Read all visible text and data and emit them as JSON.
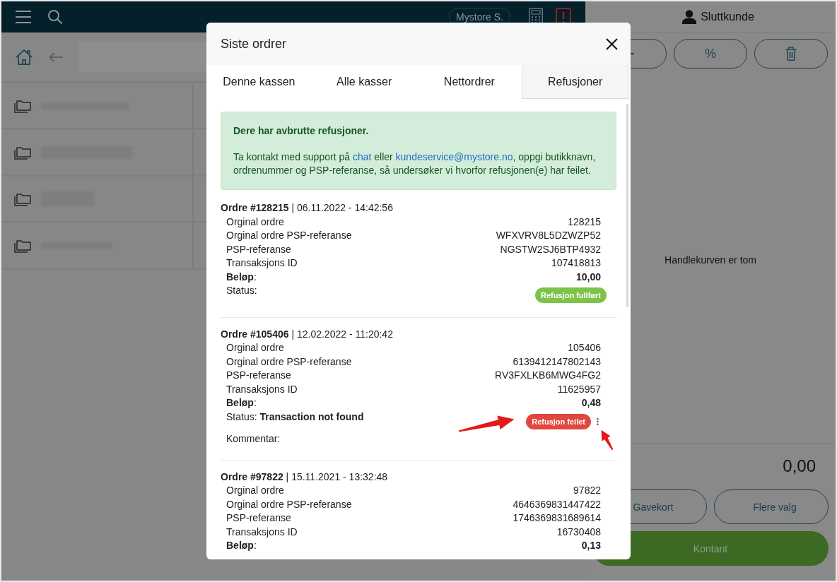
{
  "topbar": {
    "store": "Mystore S."
  },
  "cart": {
    "customer": "Sluttkunde",
    "actions": [
      {
        "kind": "minus"
      },
      {
        "kind": "label",
        "label": "%"
      },
      {
        "kind": "trash"
      }
    ],
    "empty_text": "Handlekurven er tom",
    "total": "0,00",
    "buttons": [
      {
        "label": "Gavekort",
        "kind": "outline"
      },
      {
        "label": "Flere valg",
        "kind": "outline"
      },
      {
        "label": "Kontant",
        "kind": "primary"
      }
    ]
  },
  "modal": {
    "title": "Siste ordrer",
    "tabs": [
      {
        "label": "Denne kassen",
        "selected": false
      },
      {
        "label": "Alle kasser",
        "selected": false
      },
      {
        "label": "Nettordrer",
        "selected": false
      },
      {
        "label": "Refusjoner",
        "selected": true
      }
    ],
    "notice": {
      "title": "Dere har avbrutte refusjoner.",
      "parts": [
        {
          "text": "Ta kontakt med support på ",
          "kind": "plain"
        },
        {
          "text": "chat",
          "kind": "link"
        },
        {
          "text": " eller ",
          "kind": "plain"
        },
        {
          "text": "kundeservice@mystore.no",
          "kind": "link"
        },
        {
          "text": ", oppgi butikknavn, ordrenummer og PSP-referanse, så undersøker vi hvorfor refusjonen(e) har feilet.",
          "kind": "plain"
        }
      ]
    },
    "orders": [
      {
        "heading": "**Ordre #128215** | 06.11.2022 - 14:42:56",
        "rows": [
          {
            "label": "Orginal ordre",
            "value": "128215",
            "kind": "field"
          },
          {
            "label": "Orginal ordre PSP-referanse",
            "value": "WFXVRV8L5DZWZP52",
            "kind": "field"
          },
          {
            "label": "PSP-referanse",
            "value": "NGSTW2SJ6BTP4932",
            "kind": "field"
          },
          {
            "label": "Transaksjons ID",
            "value": "107418813",
            "kind": "field"
          },
          {
            "label": "**Beløp**:",
            "value": "10,00",
            "kind": "amount"
          }
        ],
        "status": {
          "text": "Status:",
          "badge": "Refusjon fullført",
          "color": "#7dc34b",
          "menu": false
        },
        "annotated": false
      },
      {
        "heading": "**Ordre #105406** | 12.02.2022 - 11:20:42",
        "rows": [
          {
            "label": "Orginal ordre",
            "value": "105406",
            "kind": "field"
          },
          {
            "label": "Orginal ordre PSP-referanse",
            "value": "6139412147802143",
            "kind": "field"
          },
          {
            "label": "PSP-referanse",
            "value": "RV3FXLKB6MWG4FG2",
            "kind": "field"
          },
          {
            "label": "Transaksjons ID",
            "value": "11625957",
            "kind": "field"
          },
          {
            "label": "**Beløp**:",
            "value": "0,48",
            "kind": "amount"
          }
        ],
        "status": {
          "text": "Status: **Transaction not found**",
          "badge": "Refusjon feilet",
          "color": "#e2463f",
          "menu": true
        },
        "comment": "Kommentar:",
        "annotated": true
      },
      {
        "heading": "**Ordre #97822** | 15.11.2021 - 13:32:48",
        "rows": [
          {
            "label": "Orginal ordre",
            "value": "97822",
            "kind": "field"
          },
          {
            "label": "Orginal ordre PSP-referanse",
            "value": "4646369831447422",
            "kind": "field"
          },
          {
            "label": "PSP-referanse",
            "value": "1746369831689614",
            "kind": "field"
          },
          {
            "label": "Transaksjons ID",
            "value": "16730408",
            "kind": "field"
          },
          {
            "label": "**Beløp**:",
            "value": "0,13",
            "kind": "amount"
          }
        ],
        "annotated": false
      }
    ]
  }
}
